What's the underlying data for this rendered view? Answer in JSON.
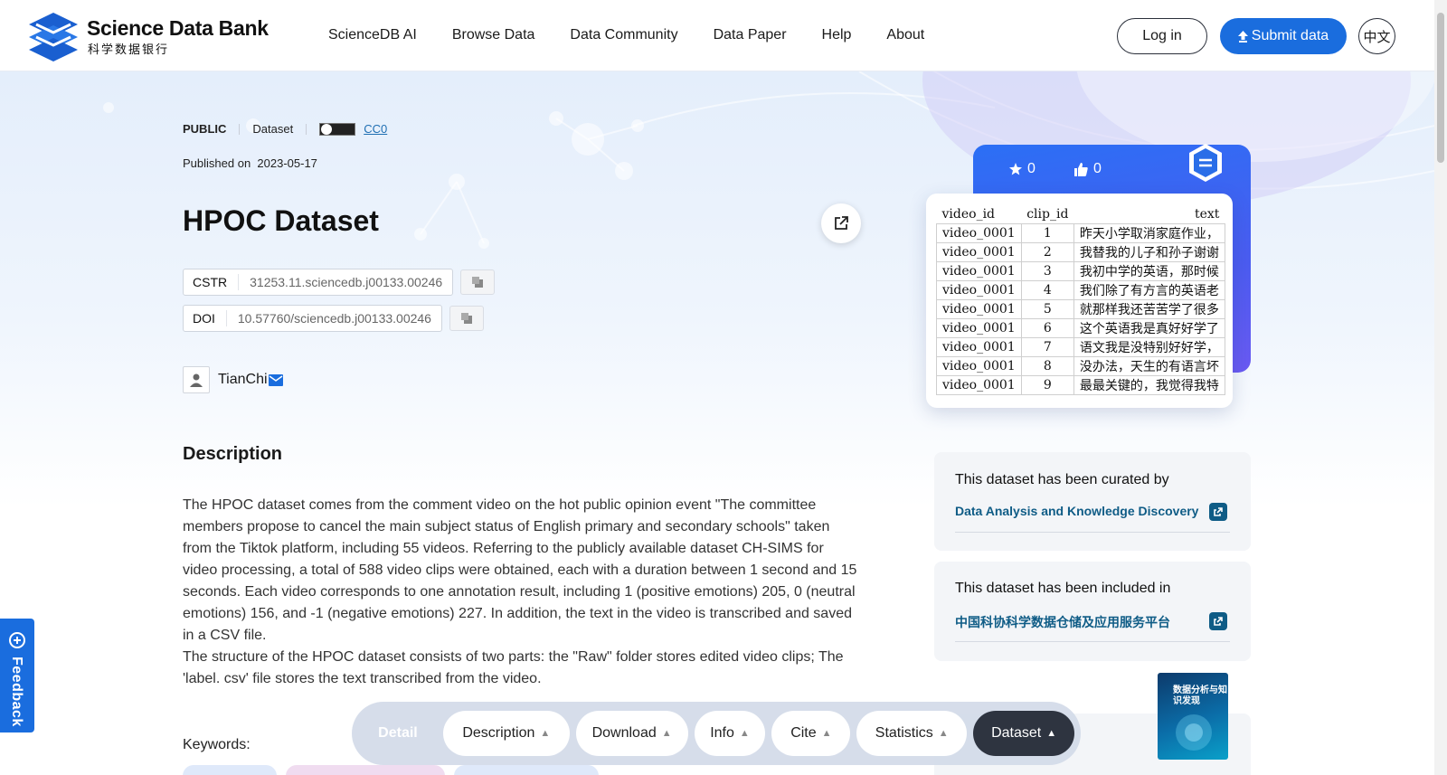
{
  "header": {
    "logo_title": "Science Data Bank",
    "logo_subtitle": "科学数据银行",
    "nav": [
      "ScienceDB AI",
      "Browse Data",
      "Data Community",
      "Data Paper",
      "Help",
      "About"
    ],
    "login_label": "Log in",
    "submit_label": "Submit data",
    "lang_label": "中文"
  },
  "dataset": {
    "visibility": "PUBLIC",
    "type": "Dataset",
    "license": "CC0",
    "published_label": "Published on",
    "published_date": "2023-05-17",
    "title": "HPOC Dataset",
    "ids": [
      {
        "label": "CSTR",
        "value": "31253.11.sciencedb.j00133.00246"
      },
      {
        "label": "DOI",
        "value": "10.57760/sciencedb.j00133.00246"
      }
    ],
    "author": "TianChi"
  },
  "description": {
    "heading": "Description",
    "paragraphs": [
      "The HPOC dataset comes from the comment video on the hot public opinion event \"The committee members propose to cancel the main subject status of English primary and secondary schools\" taken from the Tiktok platform, including 55 videos. Referring to the publicly available dataset CH-SIMS for video processing, a total of 588 video clips were obtained, each with a duration between 1 second and 15 seconds. Each video corresponds to one annotation result, including 1 (positive emotions) 205, 0 (neutral emotions) 156, and -1 (negative emotions) 227. In addition, the text in the video is transcribed and saved in a CSV file.",
      "The structure of the HPOC dataset consists of two parts: the \"Raw\" folder stores edited video clips; The 'label. csv' file stores the text transcribed from the video."
    ],
    "keywords_label": "Keywords:"
  },
  "sidebar": {
    "stars": "0",
    "likes": "0",
    "preview_table": {
      "headers": [
        "video_id",
        "clip_id",
        "text"
      ],
      "rows": [
        [
          "video_0001",
          "1",
          "昨天小学取消家庭作业，"
        ],
        [
          "video_0001",
          "2",
          "我替我的儿子和孙子谢谢"
        ],
        [
          "video_0001",
          "3",
          "我初中学的英语，那时候"
        ],
        [
          "video_0001",
          "4",
          "我们除了有方言的英语老"
        ],
        [
          "video_0001",
          "5",
          "就那样我还苦苦学了很多"
        ],
        [
          "video_0001",
          "6",
          "这个英语我是真好好学了"
        ],
        [
          "video_0001",
          "7",
          "语文我是没特别好好学，"
        ],
        [
          "video_0001",
          "8",
          "没办法，天生的有语言坏"
        ],
        [
          "video_0001",
          "9",
          "最最关键的，我觉得我特"
        ]
      ]
    },
    "curated_heading": "This dataset has been curated by",
    "curated_link": "Data Analysis and Knowledge Discovery",
    "included_heading": "This dataset has been included in",
    "included_link": "中国科协科学数据仓储及应用服务平台",
    "journal_cover_text": "数据分析与知识发现"
  },
  "tabs": [
    {
      "label": "Detail",
      "style": "first"
    },
    {
      "label": "Description",
      "style": "light"
    },
    {
      "label": "Download",
      "style": "light"
    },
    {
      "label": "Info",
      "style": "light"
    },
    {
      "label": "Cite",
      "style": "light"
    },
    {
      "label": "Statistics",
      "style": "light"
    },
    {
      "label": "Dataset",
      "style": "dark"
    }
  ],
  "feedback_label": "Feedback",
  "colors": {
    "brand": "#1a6dde",
    "link": "#0f5c86"
  }
}
